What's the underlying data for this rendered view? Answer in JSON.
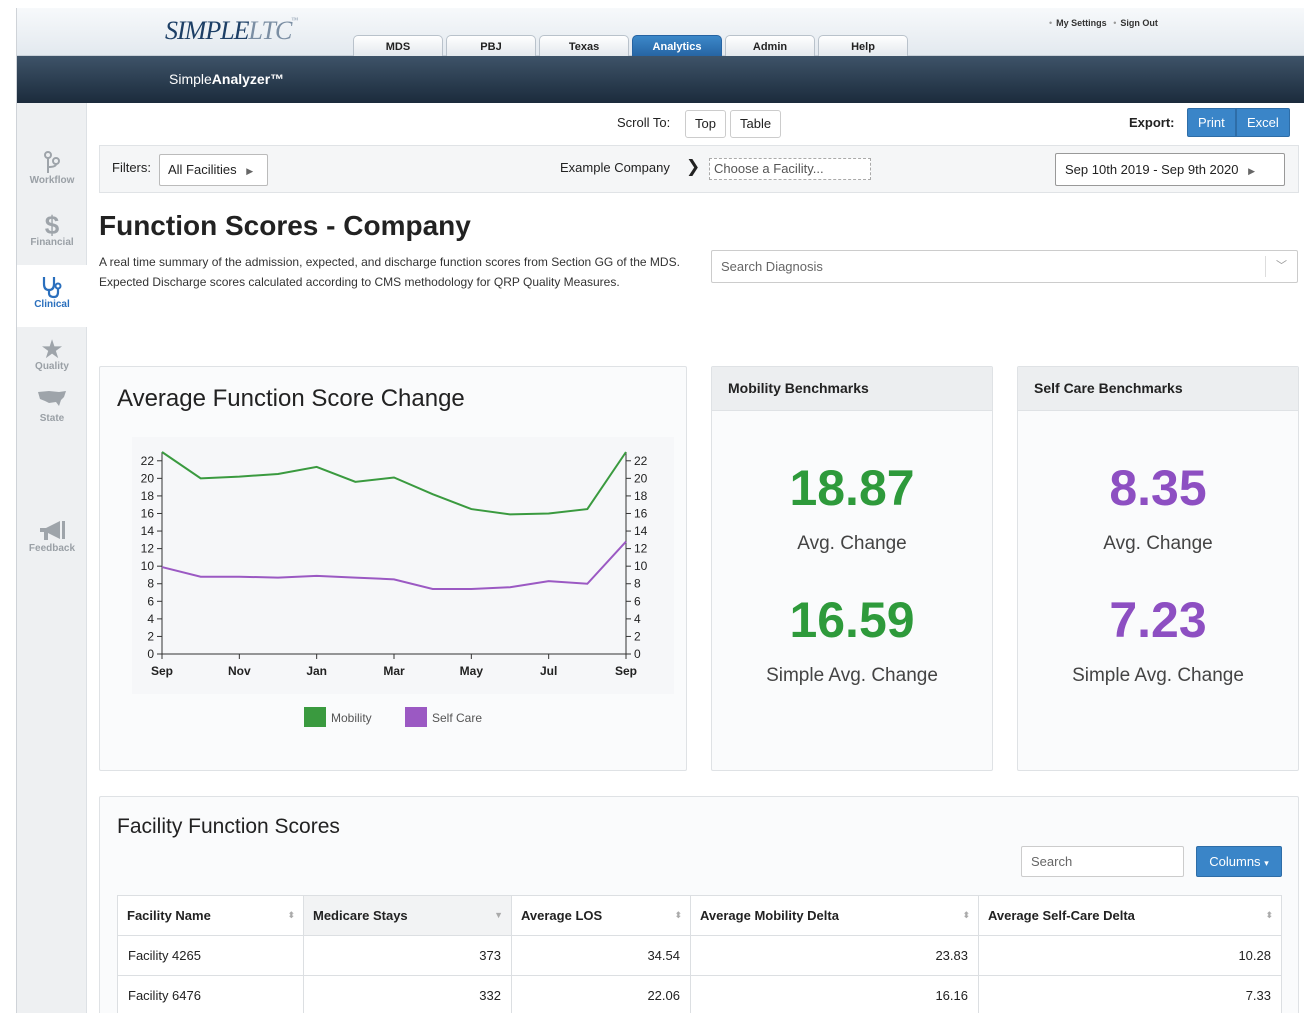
{
  "header": {
    "logo_main": "SIMPLE",
    "logo_ltc": "LTC",
    "logo_tm": "™",
    "links": [
      "My Settings",
      "Sign Out"
    ],
    "tabs": [
      "MDS",
      "PBJ",
      "Texas",
      "Analytics",
      "Admin",
      "Help"
    ],
    "active_tab": "Analytics",
    "app_title_a": "Simple",
    "app_title_b": "Analyzer™"
  },
  "sidebar": {
    "items": [
      {
        "label": "Workflow",
        "icon": "workflow-icon",
        "active": false
      },
      {
        "label": "Financial",
        "icon": "dollar-icon",
        "active": false
      },
      {
        "label": "Clinical",
        "icon": "stethoscope-icon",
        "active": true
      },
      {
        "label": "Quality",
        "icon": "star-icon",
        "active": false
      },
      {
        "label": "State",
        "icon": "usa-map-icon",
        "active": false
      },
      {
        "label": "Feedback",
        "icon": "megaphone-icon",
        "active": false
      }
    ]
  },
  "toolbar": {
    "scroll_label": "Scroll To:",
    "scroll_top": "Top",
    "scroll_table": "Table",
    "export_label": "Export:",
    "print": "Print",
    "excel": "Excel"
  },
  "filters": {
    "label": "Filters:",
    "all_facilities": "All Facilities",
    "company": "Example Company",
    "facility_placeholder": "Choose a Facility...",
    "date_range": "Sep 10th 2019 - Sep 9th 2020"
  },
  "page": {
    "title": "Function Scores - Company",
    "description": "A real time summary of the admission, expected, and discharge function scores from Section GG of the MDS. Expected Discharge scores calculated according to CMS methodology for QRP Quality Measures.",
    "diagnosis_placeholder": "Search Diagnosis"
  },
  "chart": {
    "title": "Average Function Score Change"
  },
  "chart_data": {
    "type": "line",
    "title": "Average Function Score Change",
    "x": [
      "Sep",
      "Oct",
      "Nov",
      "Dec",
      "Jan",
      "Feb",
      "Mar",
      "Apr",
      "May",
      "Jun",
      "Jul",
      "Aug",
      "Sep"
    ],
    "x_tick_labels": [
      "Sep",
      "Nov",
      "Jan",
      "Mar",
      "May",
      "Jul",
      "Sep"
    ],
    "ylim": [
      0,
      23
    ],
    "y_ticks": [
      0,
      2,
      4,
      6,
      8,
      10,
      12,
      14,
      16,
      18,
      20,
      22
    ],
    "dual_y_axis": true,
    "legend": "bottom",
    "series": [
      {
        "name": "Mobility",
        "color": "#3a9a3f",
        "values": [
          23.0,
          20.0,
          20.2,
          20.5,
          21.3,
          19.6,
          20.1,
          18.2,
          16.5,
          15.9,
          16.0,
          16.5,
          23.0
        ]
      },
      {
        "name": "Self Care",
        "color": "#9b59c3",
        "values": [
          9.9,
          8.8,
          8.8,
          8.7,
          8.9,
          8.7,
          8.5,
          7.4,
          7.4,
          7.6,
          8.3,
          8.0,
          12.8
        ]
      }
    ]
  },
  "mobility": {
    "title": "Mobility Benchmarks",
    "avg": "18.87",
    "avg_label": "Avg. Change",
    "simple_avg": "16.59",
    "simple_label": "Simple Avg. Change",
    "color": "#2e9a3b"
  },
  "selfcare": {
    "title": "Self Care Benchmarks",
    "avg": "8.35",
    "avg_label": "Avg. Change",
    "simple_avg": "7.23",
    "simple_label": "Simple Avg. Change",
    "color": "#8d4fc2"
  },
  "table": {
    "title": "Facility Function Scores",
    "search_placeholder": "Search",
    "columns_button": "Columns",
    "headers": [
      "Facility Name",
      "Medicare Stays",
      "Average LOS",
      "Average Mobility Delta",
      "Average Self-Care Delta"
    ],
    "rows": [
      [
        "Facility 4265",
        "373",
        "34.54",
        "23.83",
        "10.28"
      ],
      [
        "Facility 6476",
        "332",
        "22.06",
        "16.16",
        "7.33"
      ]
    ]
  }
}
